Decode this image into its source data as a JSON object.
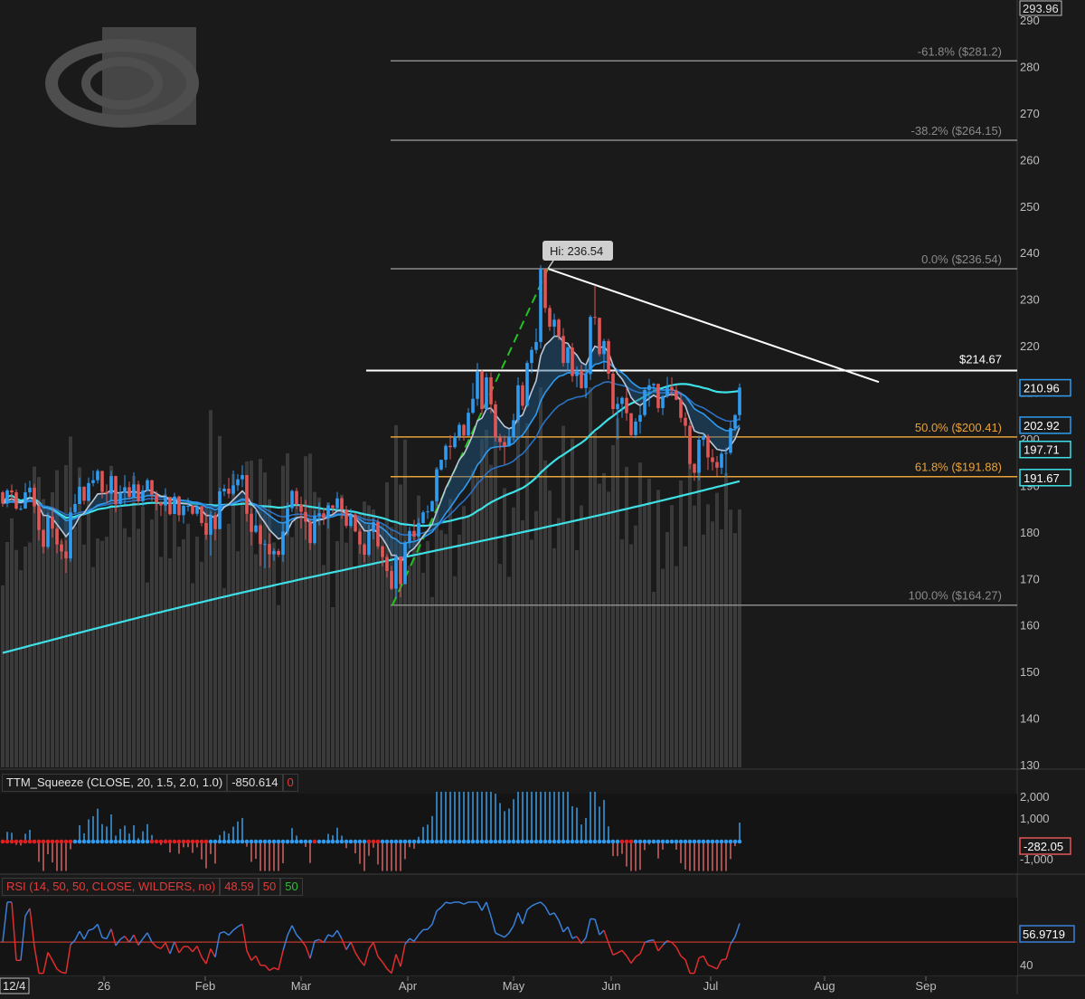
{
  "chart_data": {
    "type": "candlestick",
    "x_axis": {
      "ticks": [
        "26",
        "Feb",
        "Mar",
        "Apr",
        "May",
        "Jun",
        "Jul",
        "Aug",
        "Sep"
      ],
      "start_label": "12/4"
    },
    "price_panel": {
      "y_range": [
        130,
        292
      ],
      "y_ticks": [
        130,
        140,
        150,
        160,
        170,
        180,
        190,
        200,
        210,
        220,
        230,
        240,
        250,
        260,
        270,
        280,
        290
      ],
      "axis_top_value": "293.96",
      "high_label": "Hi: 236.54",
      "resistance_label": "$214.67",
      "resistance_level": 214.67,
      "fibonacci": [
        {
          "label": "-61.8%  ($281.2)",
          "value": 281.2,
          "color": "#8a8a8a"
        },
        {
          "label": "-38.2%  ($264.15)",
          "value": 264.15,
          "color": "#8a8a8a"
        },
        {
          "label": "0.0%  ($236.54)",
          "value": 236.54,
          "color": "#8a8a8a"
        },
        {
          "label": "50.0%  ($200.41)",
          "value": 200.41,
          "color": "#e8a23a"
        },
        {
          "label": "61.8%  ($191.88)",
          "value": 191.88,
          "color": "#e8a23a"
        },
        {
          "label": "100.0%  ($164.27)",
          "value": 164.27,
          "color": "#8a8a8a"
        }
      ],
      "price_tags": [
        {
          "text": "210.96",
          "value": 210.96,
          "color": "#2e9bf0"
        },
        {
          "text": "202.92",
          "value": 202.92,
          "color": "#2e9bf0"
        },
        {
          "text": "197.71",
          "value": 197.71,
          "color": "#3ee0e6"
        },
        {
          "text": "191.67",
          "value": 191.67,
          "color": "#3ee0e6"
        }
      ],
      "candles": [
        [
          188.5,
          188.8,
          185.4,
          186.1
        ],
        [
          186.1,
          189.3,
          185.3,
          188.9
        ],
        [
          188.9,
          190.2,
          186.8,
          188.5
        ],
        [
          188.5,
          189.1,
          184.7,
          185.0
        ],
        [
          185.0,
          185.7,
          184.6,
          185.0
        ],
        [
          185.0,
          190.5,
          185.0,
          188.5
        ],
        [
          188.5,
          191.0,
          187.3,
          189.5
        ],
        [
          189.5,
          190.3,
          184.0,
          185.5
        ],
        [
          185.5,
          186.8,
          178.2,
          180.4
        ],
        [
          180.4,
          180.6,
          175.4,
          176.8
        ],
        [
          176.8,
          184.1,
          176.4,
          183.3
        ],
        [
          183.3,
          185.3,
          178.8,
          180.7
        ],
        [
          180.7,
          181.2,
          175.4,
          177.3
        ],
        [
          177.3,
          178.5,
          174.1,
          175.8
        ],
        [
          175.8,
          178.2,
          171.2,
          174.3
        ],
        [
          174.3,
          185.3,
          173.6,
          184.2
        ],
        [
          184.2,
          188.1,
          184.0,
          186.0
        ],
        [
          186.0,
          191.7,
          186.0,
          189.7
        ],
        [
          189.7,
          189.8,
          185.9,
          186.7
        ],
        [
          186.7,
          191.7,
          186.5,
          190.5
        ],
        [
          190.5,
          193.2,
          189.8,
          191.1
        ],
        [
          191.1,
          193.5,
          190.4,
          193.1
        ],
        [
          193.1,
          193.1,
          187.2,
          188.6
        ],
        [
          188.6,
          190.2,
          186.1,
          188.2
        ],
        [
          188.2,
          193.1,
          186.7,
          192.0
        ],
        [
          192.0,
          192.1,
          184.2,
          186.0
        ],
        [
          186.0,
          190.0,
          185.3,
          188.4
        ],
        [
          188.4,
          192.2,
          185.8,
          189.6
        ],
        [
          189.6,
          190.8,
          187.0,
          187.5
        ],
        [
          187.5,
          192.8,
          187.3,
          190.2
        ],
        [
          190.2,
          191.0,
          185.8,
          186.6
        ],
        [
          186.6,
          190.0,
          185.5,
          188.9
        ],
        [
          188.9,
          191.5,
          188.7,
          191.1
        ],
        [
          191.1,
          191.2,
          186.6,
          188.0
        ],
        [
          188.0,
          188.8,
          184.6,
          186.3
        ],
        [
          186.3,
          186.6,
          183.4,
          185.7
        ],
        [
          185.7,
          189.4,
          184.4,
          187.5
        ],
        [
          187.5,
          187.5,
          183.5,
          183.8
        ],
        [
          183.8,
          188.4,
          183.8,
          187.6
        ],
        [
          187.6,
          187.8,
          182.2,
          183.6
        ],
        [
          183.6,
          185.8,
          181.8,
          185.6
        ],
        [
          185.6,
          187.3,
          184.4,
          185.6
        ],
        [
          185.6,
          185.8,
          183.6,
          183.9
        ],
        [
          183.9,
          186.4,
          183.4,
          185.5
        ],
        [
          185.5,
          185.6,
          181.2,
          181.9
        ],
        [
          181.9,
          184.1,
          178.3,
          179.4
        ],
        [
          179.4,
          184.5,
          174.9,
          183.6
        ],
        [
          183.6,
          184.3,
          178.2,
          180.6
        ],
        [
          180.6,
          189.5,
          180.6,
          188.7
        ],
        [
          188.7,
          190.2,
          187.7,
          189.3
        ],
        [
          189.3,
          191.6,
          187.2,
          188.2
        ],
        [
          188.2,
          193.2,
          187.8,
          190.0
        ],
        [
          190.0,
          192.4,
          188.8,
          191.3
        ],
        [
          191.3,
          194.3,
          189.6,
          192.2
        ],
        [
          192.2,
          192.2,
          182.2,
          183.9
        ],
        [
          183.9,
          185.1,
          177.1,
          180.0
        ],
        [
          180.0,
          184.9,
          179.7,
          181.4
        ],
        [
          181.4,
          181.7,
          172.7,
          177.4
        ],
        [
          177.4,
          178.3,
          172.2,
          177.4
        ],
        [
          177.4,
          179.7,
          172.3,
          175.2
        ],
        [
          175.2,
          176.5,
          173.8,
          175.9
        ],
        [
          175.9,
          176.4,
          174.6,
          175.1
        ],
        [
          175.1,
          181.9,
          173.6,
          180.1
        ],
        [
          180.1,
          186.3,
          179.3,
          185.1
        ],
        [
          185.1,
          189.1,
          184.3,
          188.8
        ],
        [
          188.8,
          189.5,
          184.9,
          185.9
        ],
        [
          185.9,
          187.6,
          180.7,
          184.3
        ],
        [
          184.3,
          186.9,
          178.3,
          182.2
        ],
        [
          182.2,
          182.8,
          176.1,
          177.6
        ],
        [
          177.6,
          184.6,
          177.3,
          183.5
        ],
        [
          183.5,
          186.3,
          181.4,
          184.0
        ],
        [
          184.0,
          185.2,
          181.5,
          183.0
        ],
        [
          183.0,
          186.2,
          180.7,
          185.7
        ],
        [
          185.7,
          185.8,
          183.8,
          185.1
        ],
        [
          185.1,
          188.6,
          184.6,
          187.2
        ],
        [
          187.2,
          187.6,
          182.8,
          184.8
        ],
        [
          184.8,
          185.6,
          180.8,
          181.3
        ],
        [
          181.3,
          185.0,
          180.9,
          183.7
        ],
        [
          183.7,
          184.1,
          179.9,
          180.1
        ],
        [
          180.1,
          180.7,
          175.3,
          177.3
        ],
        [
          177.3,
          177.6,
          173.5,
          175.1
        ],
        [
          175.1,
          181.5,
          174.7,
          180.0
        ],
        [
          180.0,
          182.9,
          178.4,
          182.1
        ],
        [
          182.1,
          182.8,
          176.3,
          176.9
        ],
        [
          176.9,
          177.1,
          172.6,
          174.6
        ],
        [
          174.6,
          175.2,
          170.2,
          171.6
        ],
        [
          171.6,
          172.7,
          167.5,
          167.8
        ],
        [
          167.8,
          175.2,
          165.8,
          174.7
        ],
        [
          174.7,
          174.7,
          166.0,
          168.8
        ],
        [
          168.8,
          178.1,
          168.7,
          177.6
        ],
        [
          177.6,
          181.1,
          176.5,
          180.2
        ],
        [
          180.2,
          182.6,
          178.2,
          179.0
        ],
        [
          179.0,
          183.0,
          178.2,
          181.9
        ],
        [
          181.9,
          184.6,
          181.6,
          184.2
        ],
        [
          184.2,
          185.7,
          182.8,
          184.4
        ],
        [
          184.4,
          186.8,
          184.4,
          186.6
        ],
        [
          186.6,
          193.9,
          185.6,
          193.4
        ],
        [
          193.4,
          195.5,
          193.1,
          195.5
        ],
        [
          195.5,
          198.9,
          193.8,
          198.5
        ],
        [
          198.5,
          200.8,
          195.6,
          198.2
        ],
        [
          198.2,
          201.3,
          197.9,
          200.5
        ],
        [
          200.5,
          203.5,
          199.6,
          203.0
        ],
        [
          203.0,
          203.2,
          199.6,
          200.7
        ],
        [
          200.7,
          206.6,
          200.6,
          205.6
        ],
        [
          205.6,
          212.0,
          205.3,
          208.6
        ],
        [
          208.6,
          216.3,
          207.1,
          214.4
        ],
        [
          214.4,
          214.8,
          205.3,
          206.4
        ],
        [
          206.4,
          214.1,
          206.1,
          213.2
        ],
        [
          213.2,
          214.3,
          205.5,
          207.4
        ],
        [
          207.4,
          208.2,
          199.4,
          200.3
        ],
        [
          200.3,
          201.1,
          197.5,
          199.3
        ],
        [
          199.3,
          200.7,
          194.5,
          198.4
        ],
        [
          198.4,
          202.0,
          198.3,
          200.4
        ],
        [
          200.4,
          205.4,
          199.5,
          204.0
        ],
        [
          204.0,
          213.2,
          203.4,
          211.5
        ],
        [
          211.5,
          212.2,
          206.2,
          207.1
        ],
        [
          207.1,
          216.8,
          206.9,
          216.3
        ],
        [
          216.3,
          219.8,
          214.1,
          219.1
        ],
        [
          219.1,
          223.7,
          218.3,
          220.8
        ],
        [
          220.8,
          237.3,
          219.4,
          236.5
        ],
        [
          236.5,
          236.5,
          227.1,
          228.1
        ],
        [
          228.1,
          228.7,
          223.2,
          224.1
        ],
        [
          224.1,
          226.9,
          222.0,
          225.6
        ],
        [
          225.6,
          225.9,
          221.2,
          222.1
        ],
        [
          222.1,
          223.8,
          215.5,
          216.3
        ],
        [
          216.3,
          219.8,
          214.5,
          219.6
        ],
        [
          219.6,
          220.6,
          212.2,
          213.5
        ],
        [
          213.5,
          215.6,
          211.1,
          214.6
        ],
        [
          214.6,
          215.9,
          210.7,
          210.9
        ],
        [
          210.9,
          216.0,
          208.7,
          213.9
        ],
        [
          213.9,
          226.6,
          212.6,
          226.2
        ],
        [
          226.2,
          233.0,
          224.5,
          226.0
        ],
        [
          226.0,
          226.0,
          217.7,
          218.2
        ],
        [
          218.2,
          221.5,
          214.6,
          221.0
        ],
        [
          221.0,
          221.5,
          212.8,
          214.0
        ],
        [
          214.0,
          214.6,
          205.1,
          206.4
        ],
        [
          206.4,
          209.0,
          199.9,
          207.5
        ],
        [
          207.5,
          209.1,
          204.5,
          208.8
        ],
        [
          208.8,
          210.9,
          203.9,
          205.5
        ],
        [
          205.5,
          205.5,
          200.3,
          200.8
        ],
        [
          200.8,
          204.4,
          200.1,
          203.7
        ],
        [
          203.7,
          207.2,
          201.1,
          205.1
        ],
        [
          205.1,
          211.1,
          204.7,
          210.5
        ],
        [
          210.5,
          212.9,
          206.9,
          211.5
        ],
        [
          211.5,
          212.0,
          210.0,
          211.8
        ],
        [
          211.8,
          211.9,
          205.7,
          206.6
        ],
        [
          206.6,
          209.4,
          205.1,
          209.1
        ],
        [
          209.1,
          213.3,
          208.8,
          211.1
        ],
        [
          211.1,
          213.2,
          209.1,
          210.4
        ],
        [
          210.4,
          211.6,
          208.3,
          208.4
        ],
        [
          208.4,
          210.0,
          203.5,
          204.5
        ],
        [
          204.5,
          205.7,
          200.3,
          202.8
        ],
        [
          202.8,
          203.6,
          193.5,
          194.6
        ],
        [
          194.6,
          194.8,
          191.0,
          192.7
        ],
        [
          192.7,
          200.7,
          191.1,
          199.8
        ],
        [
          199.8,
          201.3,
          198.4,
          200.6
        ],
        [
          200.6,
          201.0,
          193.3,
          196.0
        ],
        [
          196.0,
          197.8,
          193.2,
          195.0
        ],
        [
          195.0,
          196.3,
          192.0,
          193.8
        ],
        [
          193.8,
          197.4,
          192.4,
          196.8
        ],
        [
          196.8,
          198.1,
          191.7,
          197.0
        ],
        [
          197.0,
          203.7,
          196.6,
          202.3
        ],
        [
          202.3,
          205.3,
          201.7,
          205.1
        ],
        [
          205.1,
          211.9,
          203.9,
          211.0
        ]
      ],
      "volume": [
        [
          1,
          0.12
        ],
        [
          2,
          0.34
        ],
        [
          3,
          0.22
        ],
        [
          4,
          0.51
        ],
        [
          5,
          0.28
        ]
      ]
    },
    "squeeze_panel": {
      "title": "TTM_Squeeze (CLOSE, 20, 1.5, 2.0, 1.0)",
      "value": "-850.614",
      "value2": "0",
      "y_ticks": [
        "2,000",
        "1,000",
        "-1,000"
      ],
      "last_value_tag": "-282.05"
    },
    "rsi_panel": {
      "title": "RSI (14, 50, 50, CLOSE, WILDERS, no)",
      "value": "48.59",
      "oversold": "50",
      "overbought": "50",
      "y_ticks": [
        "40"
      ],
      "last_value_tag": "56.9719"
    }
  }
}
